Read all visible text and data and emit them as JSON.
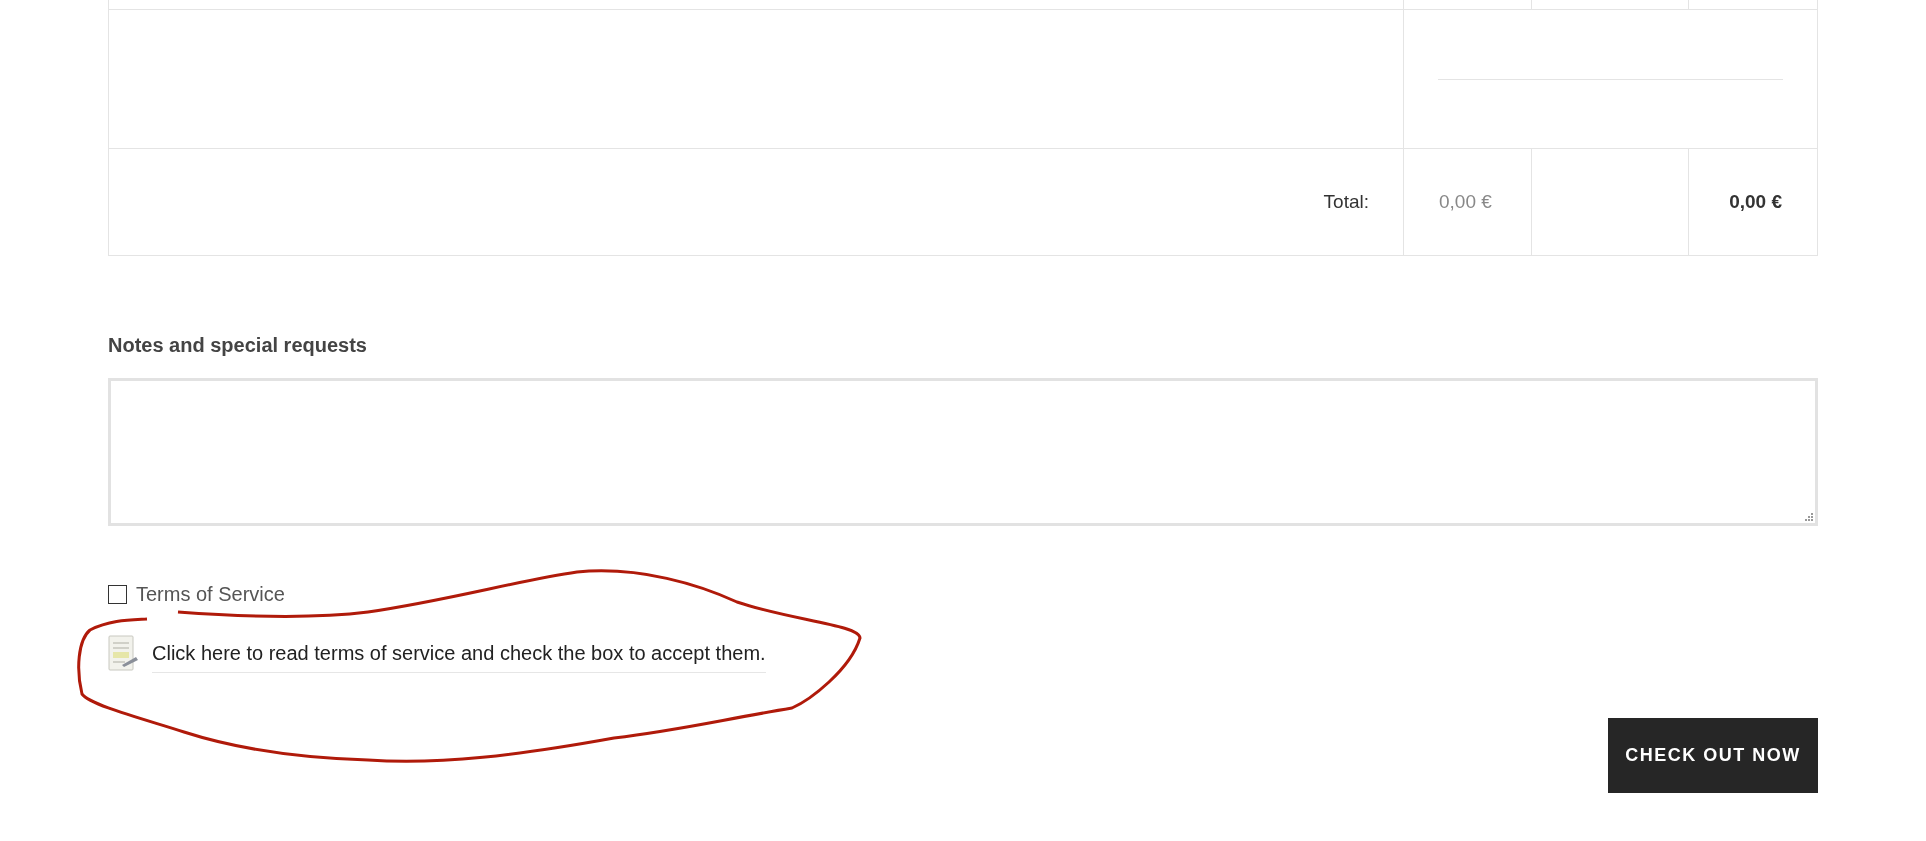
{
  "table": {
    "rows": [
      {
        "kind": "cut"
      },
      {
        "kind": "blank"
      },
      {
        "kind": "total",
        "label": "Total:",
        "column_2": "0,00 €",
        "column_4": "0,00 €"
      }
    ]
  },
  "notes": {
    "heading": "Notes and special requests"
  },
  "terms": {
    "label": "Terms of Service",
    "checked": false,
    "link": "Click here to read terms of service and check the box to accept them."
  },
  "button": "CHECK OUT NOW"
}
